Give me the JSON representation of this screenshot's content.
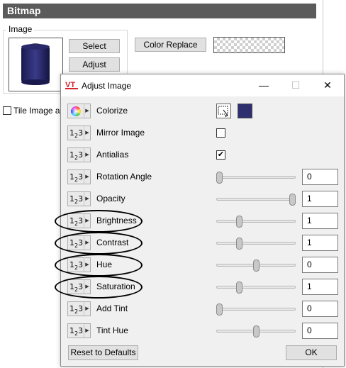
{
  "background": {
    "section_title": "Bitmap",
    "group_label": "Image",
    "select_label": "Select",
    "adjust_label": "Adjust",
    "color_replace_label": "Color Replace",
    "tile_label": "Tile Image and"
  },
  "dialog": {
    "title": "Adjust Image",
    "minimize": "—",
    "maximize": "☐",
    "close": "✕",
    "reset_label": "Reset to Defaults",
    "ok_label": "OK",
    "colorize_swatch_color": "#2e2f6e",
    "rows": [
      {
        "label": "Colorize",
        "kind": "color"
      },
      {
        "label": "Mirror Image",
        "kind": "check",
        "checked": false
      },
      {
        "label": "Antialias",
        "kind": "check",
        "checked": true,
        "check_mark": "✔"
      },
      {
        "label": "Rotation Angle",
        "kind": "slider",
        "slider_fraction": 0.0,
        "value": "0"
      },
      {
        "label": "Opacity",
        "kind": "slider",
        "slider_fraction": 1.0,
        "value": "1"
      },
      {
        "label": "Brightness",
        "kind": "slider",
        "slider_fraction": 0.27,
        "value": "1",
        "highlighted": true
      },
      {
        "label": "Contrast",
        "kind": "slider",
        "slider_fraction": 0.27,
        "value": "1",
        "highlighted": true
      },
      {
        "label": "Hue",
        "kind": "slider",
        "slider_fraction": 0.5,
        "value": "0",
        "highlighted": true
      },
      {
        "label": "Saturation",
        "kind": "slider",
        "slider_fraction": 0.27,
        "value": "1",
        "highlighted": true
      },
      {
        "label": "Add Tint",
        "kind": "slider",
        "slider_fraction": 0.0,
        "value": "0"
      },
      {
        "label": "Tint Hue",
        "kind": "slider",
        "slider_fraction": 0.5,
        "value": "0"
      }
    ]
  },
  "icons": {
    "type_number": "number-type-icon",
    "type_color": "color-wheel-icon",
    "picker": "eyedropper-icon"
  }
}
